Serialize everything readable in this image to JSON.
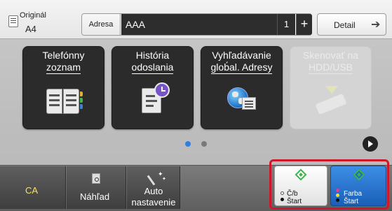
{
  "header": {
    "original_label": "Originál",
    "original_size": "A4",
    "address_label": "Adresa",
    "address_value": "AAA",
    "address_count": "1",
    "add_symbol": "+",
    "detail_label": "Detail"
  },
  "tiles": [
    {
      "line1": "Telefónny",
      "line2": "zoznam",
      "enabled": true,
      "icon": "phonebook-icon"
    },
    {
      "line1": "História",
      "line2": "odoslania",
      "enabled": true,
      "icon": "history-icon"
    },
    {
      "line1": "Vyhľadávanie",
      "line2": "glob́al. Adresy",
      "enabled": true,
      "icon": "global-address-icon"
    },
    {
      "line1": "Skenovať na",
      "line2": "HDD/USB",
      "enabled": false,
      "icon": "hdd-usb-icon"
    }
  ],
  "pagination": {
    "current": 1,
    "total": 2
  },
  "bottom": {
    "ca_label": "CA",
    "preview_label": "Náhľad",
    "auto_line1": "Auto",
    "auto_line2": "nastavenie",
    "start_bw_line1": "Č/b",
    "start_bw_line2": "Štart",
    "start_color_line1": "Farba",
    "start_color_line2": "Štart"
  },
  "colors": {
    "highlight_frame": "#d2162a",
    "start_color_button": "#1a5fb8",
    "ca_text": "#f3e26a",
    "start_indicator": "#3bb54a"
  }
}
